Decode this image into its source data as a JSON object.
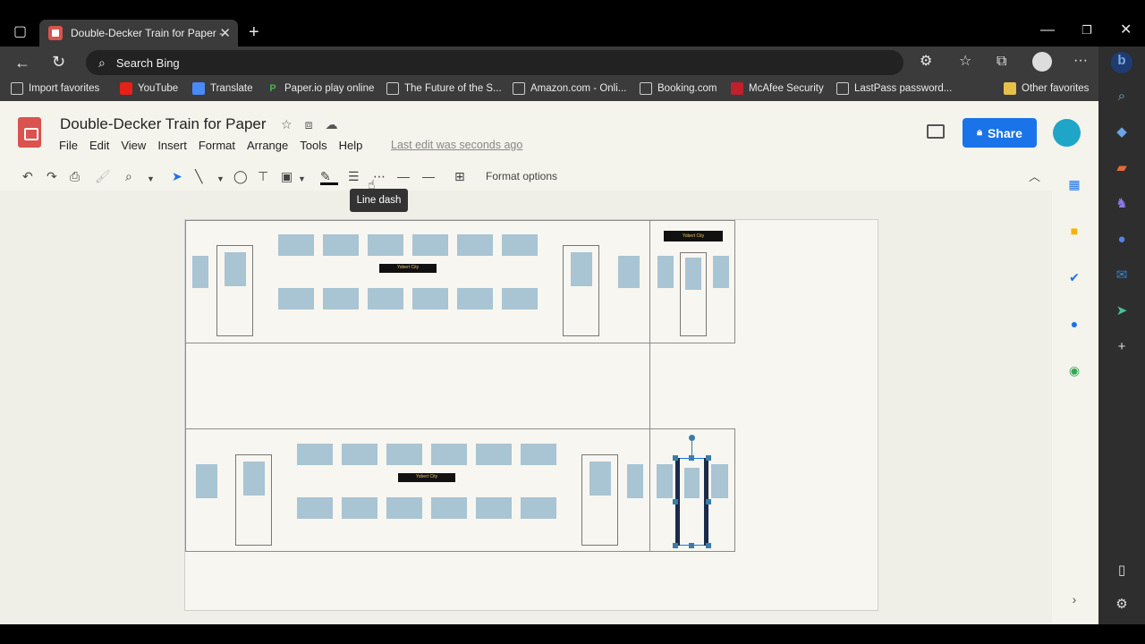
{
  "browser": {
    "tab_title": "Double-Decker Train for Paper - ",
    "address_placeholder": "Search Bing",
    "favorites": [
      {
        "label": "Import favorites"
      },
      {
        "label": "YouTube"
      },
      {
        "label": "Translate"
      },
      {
        "label": "Paper.io play online"
      },
      {
        "label": "The Future of the S..."
      },
      {
        "label": "Amazon.com - Onli..."
      },
      {
        "label": "Booking.com"
      },
      {
        "label": "McAfee Security"
      },
      {
        "label": "LastPass password..."
      },
      {
        "label": "Other favorites"
      }
    ]
  },
  "doc": {
    "title": "Double-Decker Train for Paper",
    "menu": [
      "File",
      "Edit",
      "View",
      "Insert",
      "Format",
      "Arrange",
      "Tools",
      "Help"
    ],
    "last_edit": "Last edit was seconds ago",
    "share_label": "Share"
  },
  "toolbar": {
    "format_options": "Format options",
    "tooltip": "Line dash"
  },
  "slide": {
    "sign_text": "Yobert City"
  }
}
